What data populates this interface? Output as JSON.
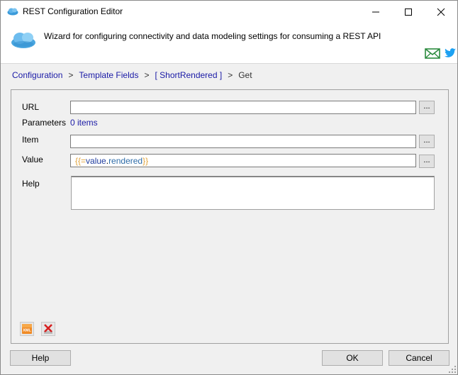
{
  "window": {
    "title": "REST Configuration Editor",
    "controls": {
      "minimize": "minimize",
      "maximize": "maximize",
      "close": "close"
    }
  },
  "header": {
    "description": "Wizard for configuring connectivity and data modeling settings for consuming a REST API",
    "icons": [
      "cloud-icon",
      "mail-icon",
      "twitter-icon"
    ]
  },
  "breadcrumb": {
    "items": [
      "Configuration",
      "Template Fields",
      "[ ShortRendered ]"
    ],
    "separator": ">",
    "current": "Get"
  },
  "form": {
    "url_label": "URL",
    "url_value": "",
    "parameters_label": "Parameters",
    "parameters_value": "0 items",
    "item_label": "Item",
    "item_value": "",
    "value_label": "Value",
    "value_expression": {
      "open": "{{",
      "eq": "=",
      "keyword": "value",
      "dot": ".",
      "member": "rendered",
      "close": "}}"
    },
    "help_label": "Help",
    "help_value": "",
    "ellipsis": "..."
  },
  "toolbar": {
    "xml_icon": "xml-icon",
    "delete_icon": "delete-icon"
  },
  "buttons": {
    "help": "Help",
    "ok": "OK",
    "cancel": "Cancel"
  },
  "colors": {
    "link": "#1a1aa6",
    "brace": "#e0a23a",
    "keyword": "#1e3b9e",
    "member": "#2e6ca8"
  }
}
